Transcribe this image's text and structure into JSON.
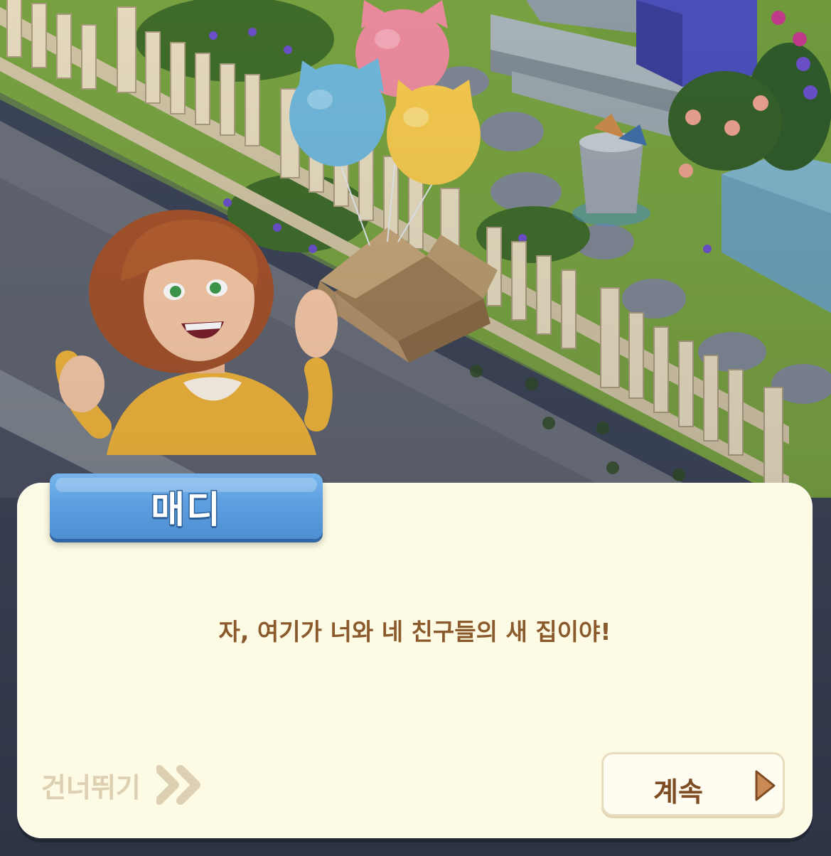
{
  "speaker": {
    "name": "매디"
  },
  "dialog": {
    "message": "자, 여기가 너와 네 친구들의 새 집이야!"
  },
  "controls": {
    "skip_label": "건너뛰기",
    "continue_label": "계속"
  },
  "icons": {
    "skip": "double-chevron-right-icon",
    "continue": "triangle-right-icon"
  },
  "colors": {
    "dialog_bg": "#fefbe4",
    "name_plate": "#5d9fe0",
    "message_text": "#8a5a2c",
    "skip_text": "#dccfb2",
    "continue_text": "#7e4c22",
    "continue_arrow": "#c98a55"
  }
}
